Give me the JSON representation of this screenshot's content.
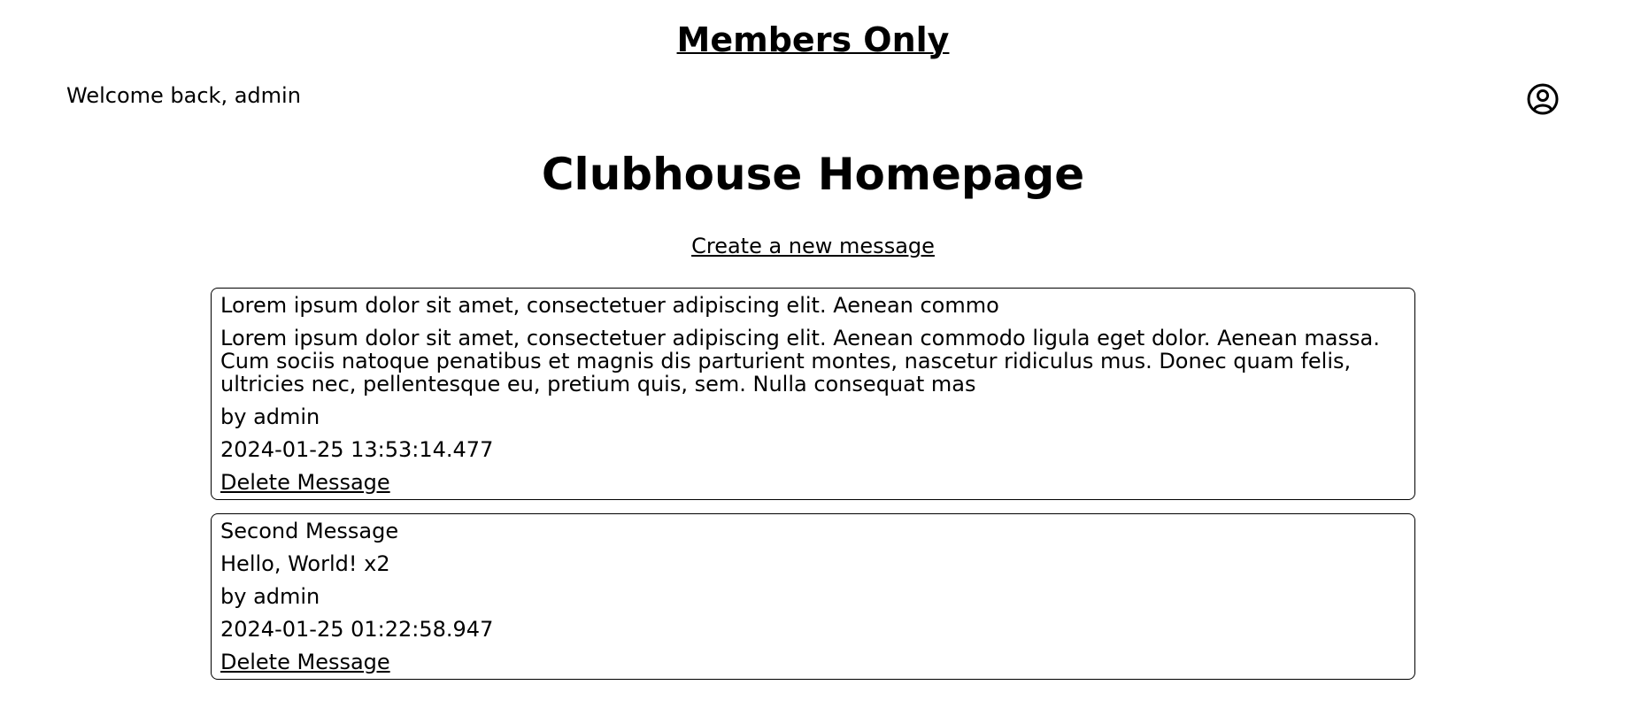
{
  "header": {
    "site_title": "Members Only",
    "welcome_text": "Welcome back, admin",
    "profile_icon": "user-circle-icon"
  },
  "main": {
    "heading": "Clubhouse Homepage",
    "create_link": "Create a new message"
  },
  "messages": [
    {
      "title": "Lorem ipsum dolor sit amet, consectetuer adipiscing elit. Aenean commo",
      "body": "Lorem ipsum dolor sit amet, consectetuer adipiscing elit. Aenean commodo ligula eget dolor. Aenean massa. Cum sociis natoque penatibus et magnis dis parturient montes, nascetur ridiculus mus. Donec quam felis, ultricies nec, pellentesque eu, pretium quis, sem. Nulla consequat mas",
      "author": "by admin",
      "timestamp": "2024-01-25 13:53:14.477",
      "delete_label": "Delete Message"
    },
    {
      "title": "Second Message",
      "body": "Hello, World! x2",
      "author": "by admin",
      "timestamp": "2024-01-25 01:22:58.947",
      "delete_label": "Delete Message"
    }
  ]
}
